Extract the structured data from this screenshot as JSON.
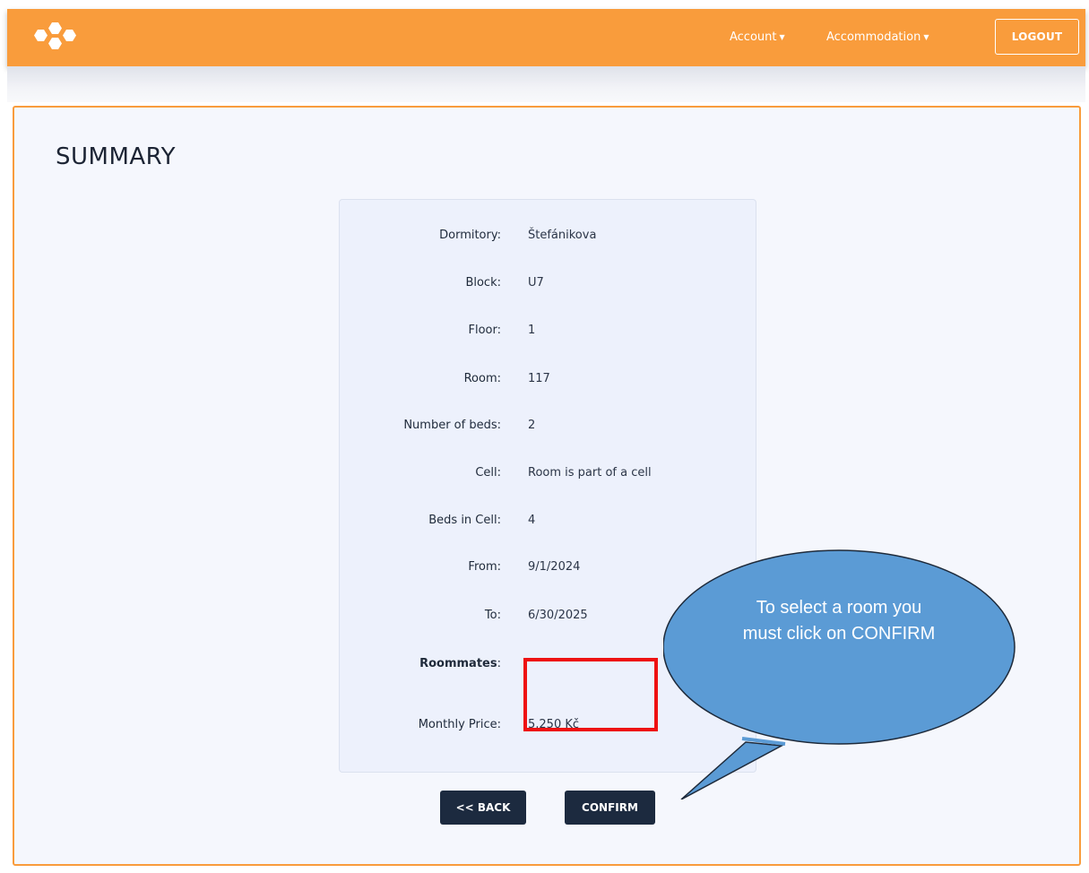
{
  "navbar": {
    "account_label": "Account",
    "accommodation_label": "Accommodation",
    "logout_label": "LOGOUT",
    "logo_icon": "hexagon-cluster-logo-icon",
    "background_color": "#f99c3c"
  },
  "page": {
    "title": "SUMMARY"
  },
  "summary": {
    "rows": [
      {
        "label": "Dormitory:",
        "value": "Štefánikova"
      },
      {
        "label": "Block:",
        "value": "U7"
      },
      {
        "label": "Floor:",
        "value": "1"
      },
      {
        "label": "Room:",
        "value": "117"
      },
      {
        "label": "Number of beds:",
        "value": "2"
      },
      {
        "label": "Cell:",
        "value": "Room is part of a cell"
      },
      {
        "label": "Beds in Cell:",
        "value": "4"
      },
      {
        "label": "From:",
        "value": "9/1/2024"
      },
      {
        "label": "To:",
        "value": "6/30/2025"
      },
      {
        "label": "Roommates",
        "label_suffix": ":",
        "value": ""
      },
      {
        "label": "Monthly Price:",
        "value": "5,250 Kč"
      }
    ]
  },
  "actions": {
    "back_label": "<< BACK",
    "confirm_label": "CONFIRM"
  },
  "annotation": {
    "callout_text": "To select a room you must click on CONFIRM",
    "highlight_color": "#ee1111",
    "callout_color": "#5b9bd5"
  }
}
